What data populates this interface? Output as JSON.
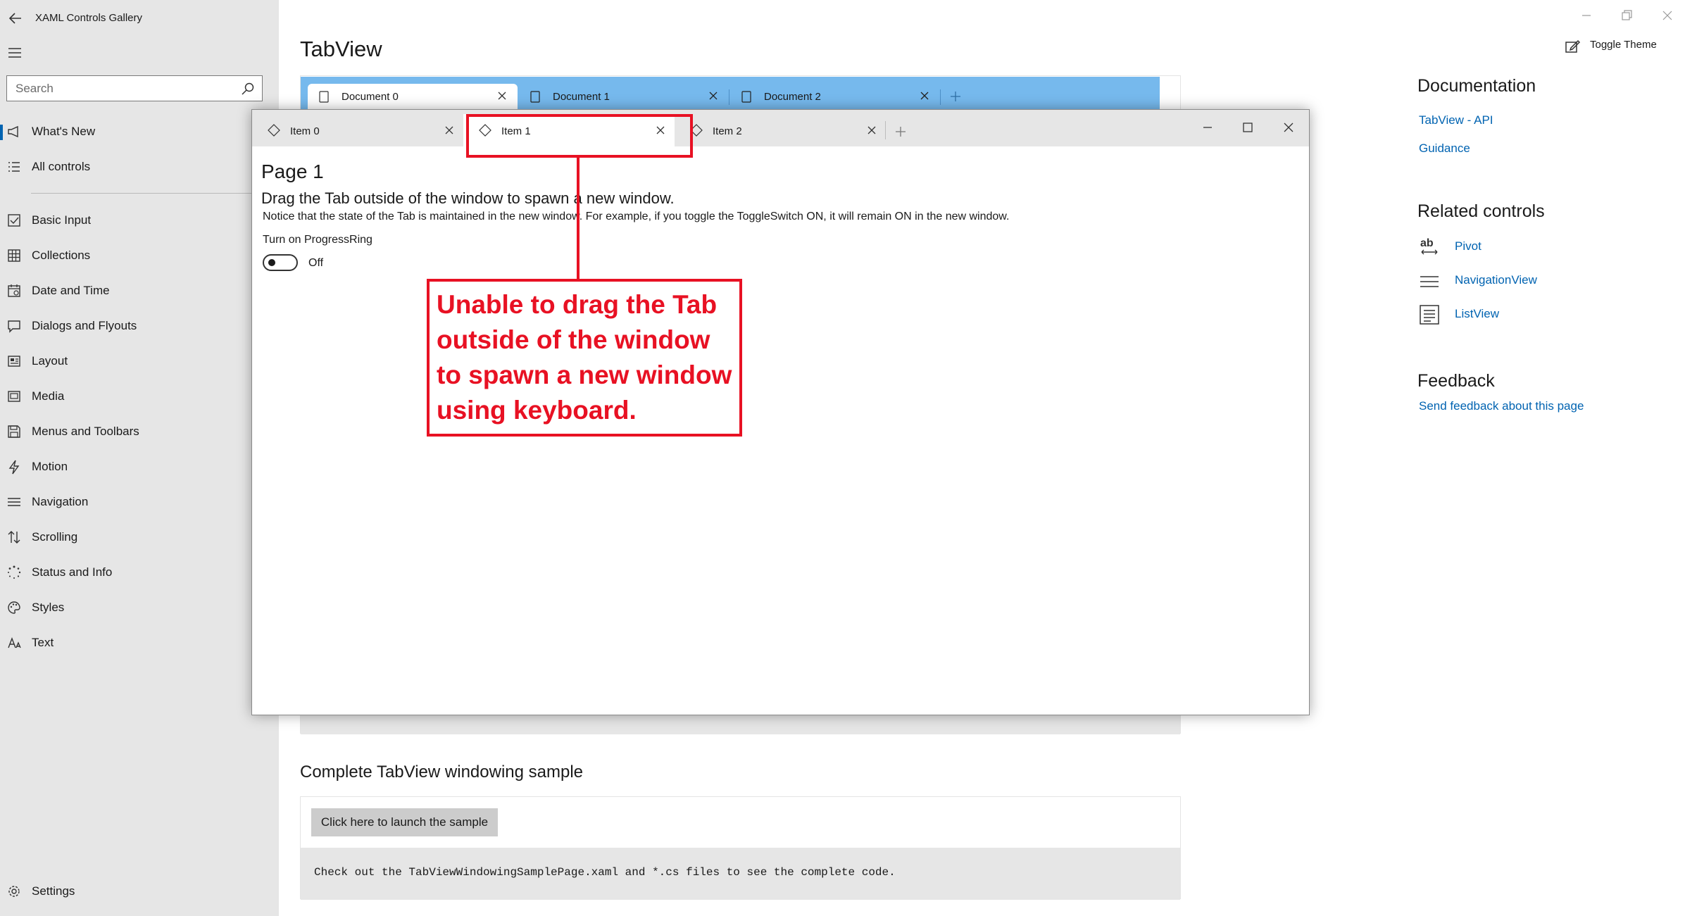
{
  "app": {
    "title": "XAML Controls Gallery"
  },
  "search": {
    "placeholder": "Search"
  },
  "nav": {
    "items": [
      {
        "label": "What's New",
        "icon": "megaphone-icon"
      },
      {
        "label": "All controls",
        "icon": "list-icon"
      },
      {
        "label": "Basic Input",
        "icon": "checkbox-icon"
      },
      {
        "label": "Collections",
        "icon": "grid-icon"
      },
      {
        "label": "Date and Time",
        "icon": "calendar-icon"
      },
      {
        "label": "Dialogs and Flyouts",
        "icon": "chat-icon"
      },
      {
        "label": "Layout",
        "icon": "layout-icon"
      },
      {
        "label": "Media",
        "icon": "media-icon"
      },
      {
        "label": "Menus and Toolbars",
        "icon": "save-icon"
      },
      {
        "label": "Motion",
        "icon": "lightning-icon"
      },
      {
        "label": "Navigation",
        "icon": "hamburger-icon"
      },
      {
        "label": "Scrolling",
        "icon": "updown-arrows-icon"
      },
      {
        "label": "Status and Info",
        "icon": "progress-ring-icon"
      },
      {
        "label": "Styles",
        "icon": "palette-icon"
      },
      {
        "label": "Text",
        "icon": "font-icon"
      }
    ],
    "settings_label": "Settings"
  },
  "page": {
    "title": "TabView",
    "toggle_theme": "Toggle Theme"
  },
  "doc_tabs": [
    "Document 0",
    "Document 1",
    "Document 2"
  ],
  "window": {
    "tabs": [
      "Item 0",
      "Item 1",
      "Item 2"
    ],
    "page_title": "Page 1",
    "heading": "Drag the Tab outside of the window to spawn a new window.",
    "note": "Notice that the state of the Tab is maintained in the new window. For example, if you toggle the ToggleSwitch ON, it will remain ON in the new window.",
    "toggle_label": "Turn on ProgressRing",
    "toggle_state": "Off"
  },
  "annotation": {
    "text": "Unable to drag the Tab outside of the window to spawn a new window using keyboard."
  },
  "complete_sample": {
    "title": "Complete TabView windowing sample",
    "button": "Click here to launch the sample",
    "code_note": "Check out the TabViewWindowingSamplePage.xaml and *.cs files to see the complete code."
  },
  "right_pane": {
    "documentation": {
      "title": "Documentation",
      "links": [
        "TabView - API",
        "Guidance"
      ]
    },
    "related": {
      "title": "Related controls",
      "items": [
        "Pivot",
        "NavigationView",
        "ListView"
      ]
    },
    "feedback": {
      "title": "Feedback",
      "link": "Send feedback about this page"
    }
  },
  "colors": {
    "accent": "#0063b1",
    "tabstrip": "#76b9ed",
    "annotation": "#e81123"
  }
}
